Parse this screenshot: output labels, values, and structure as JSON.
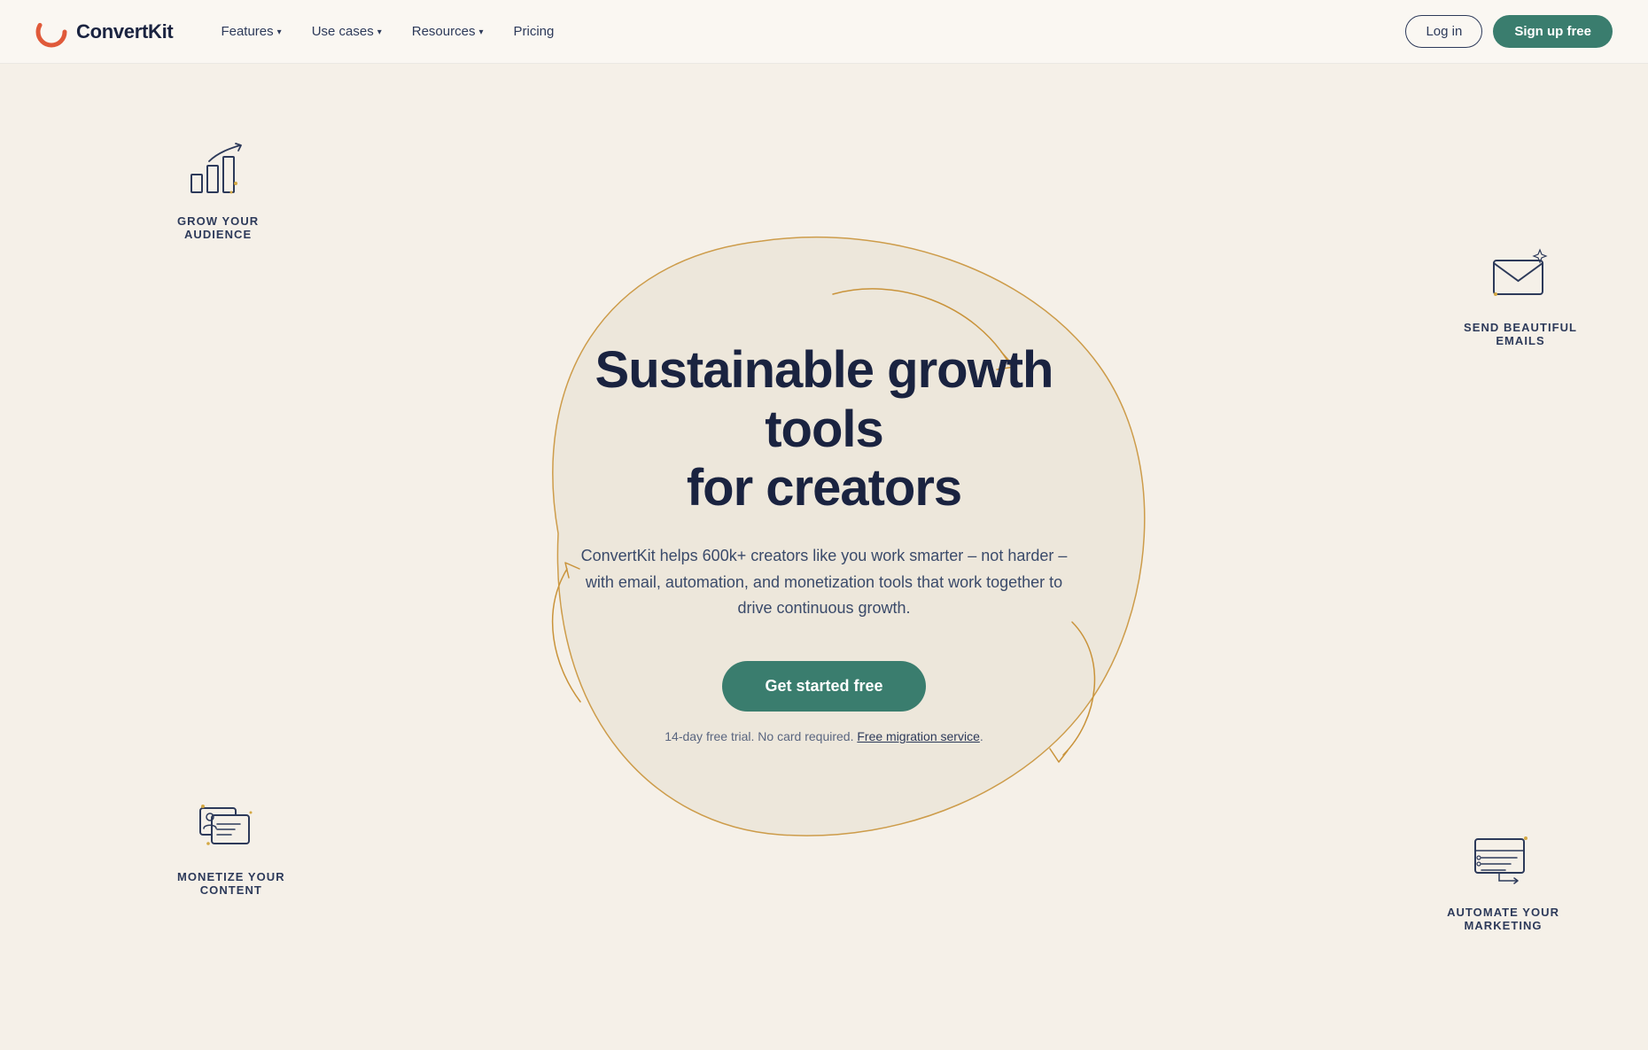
{
  "nav": {
    "logo_text": "ConvertKit",
    "items": [
      {
        "label": "Features",
        "has_dropdown": true
      },
      {
        "label": "Use cases",
        "has_dropdown": true
      },
      {
        "label": "Resources",
        "has_dropdown": true
      },
      {
        "label": "Pricing",
        "has_dropdown": false
      }
    ],
    "login_label": "Log in",
    "signup_label": "Sign up free"
  },
  "hero": {
    "title_line1": "Sustainable growth tools",
    "title_line2": "for creators",
    "subtitle": "ConvertKit helps 600k+ creators like you work smarter – not harder – with email, automation, and monetization tools that work together to drive continuous growth.",
    "cta_label": "Get started free",
    "trial_text": "14-day free trial. No card required.",
    "migration_link": "Free migration service",
    "migration_suffix": "."
  },
  "callouts": {
    "grow": {
      "label_line1": "GROW YOUR",
      "label_line2": "AUDIENCE"
    },
    "email": {
      "label_line1": "SEND BEAUTIFUL",
      "label_line2": "EMAILS"
    },
    "monetize": {
      "label_line1": "MONETIZE YOUR",
      "label_line2": "CONTENT"
    },
    "automate": {
      "label_line1": "AUTOMATE YOUR",
      "label_line2": "MARKETING"
    }
  },
  "colors": {
    "primary": "#3a7d6e",
    "nav_border": "#2d3a5a",
    "blob_stroke": "#d4a843",
    "bg": "#f5f0e8"
  }
}
